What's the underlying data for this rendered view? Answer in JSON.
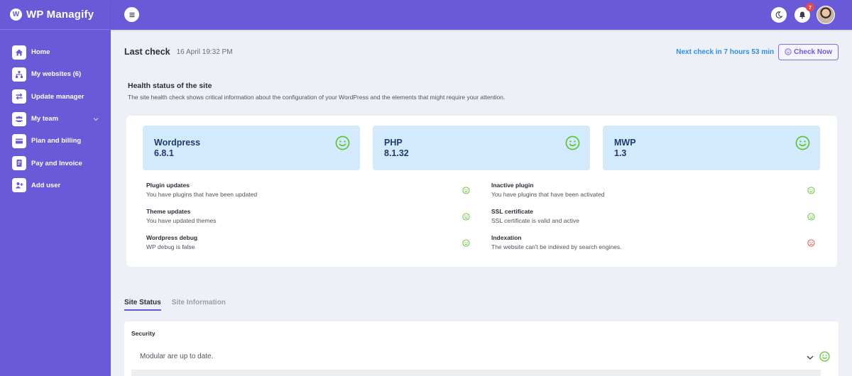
{
  "brand": {
    "name": "WP Managify",
    "logo_letter": "W"
  },
  "sidebar": {
    "items": [
      {
        "label": "Home",
        "icon": "home-icon"
      },
      {
        "label": "My websites (6)",
        "icon": "sitemap-icon"
      },
      {
        "label": "Update manager",
        "icon": "arrows-icon"
      },
      {
        "label": "My team",
        "icon": "team-icon",
        "has_submenu": true
      },
      {
        "label": "Plan and billing",
        "icon": "card-icon"
      },
      {
        "label": "Pay and Invoice",
        "icon": "invoice-icon"
      },
      {
        "label": "Add user",
        "icon": "user-plus-icon"
      }
    ]
  },
  "topbar": {
    "notifications_count": "7"
  },
  "check": {
    "title": "Last check",
    "date": "16 April 19:32 PM",
    "next": "Next check in 7 hours 53 min",
    "button": "Check Now"
  },
  "health": {
    "title": "Health status of the site",
    "description": "The site health check shows critical information about the configuration of your WordPress and the elements that might require your attention.",
    "tiles": [
      {
        "name": "Wordpress",
        "version": "6.8.1",
        "status": "good"
      },
      {
        "name": "PHP",
        "version": "8.1.32",
        "status": "good"
      },
      {
        "name": "MWP",
        "version": "1.3",
        "status": "good"
      }
    ],
    "checks": [
      {
        "title": "Plugin updates",
        "desc": "You have plugins that have been updated",
        "status": "good"
      },
      {
        "title": "Inactive plugin",
        "desc": "You have plugins that have been activated",
        "status": "good"
      },
      {
        "title": "Theme updates",
        "desc": "You have updated themes",
        "status": "good"
      },
      {
        "title": "SSL certificate",
        "desc": "SSL certificate is valid and active",
        "status": "good"
      },
      {
        "title": "Wordpress debug",
        "desc": "WP debug is false",
        "status": "good"
      },
      {
        "title": "Indexation",
        "desc": "The website can't be indexed by search engines.",
        "status": "bad"
      }
    ]
  },
  "tabs": [
    {
      "label": "Site Status",
      "active": true
    },
    {
      "label": "Site Information",
      "active": false
    }
  ],
  "status": {
    "section_title": "Security",
    "row_text": "Modular are up to date.",
    "row_status": "good"
  },
  "colors": {
    "accent": "#6a5ad8",
    "good": "#5cc12e",
    "bad": "#e5484d",
    "tile_bg": "#d3e9fc",
    "link": "#2f8fe0"
  }
}
